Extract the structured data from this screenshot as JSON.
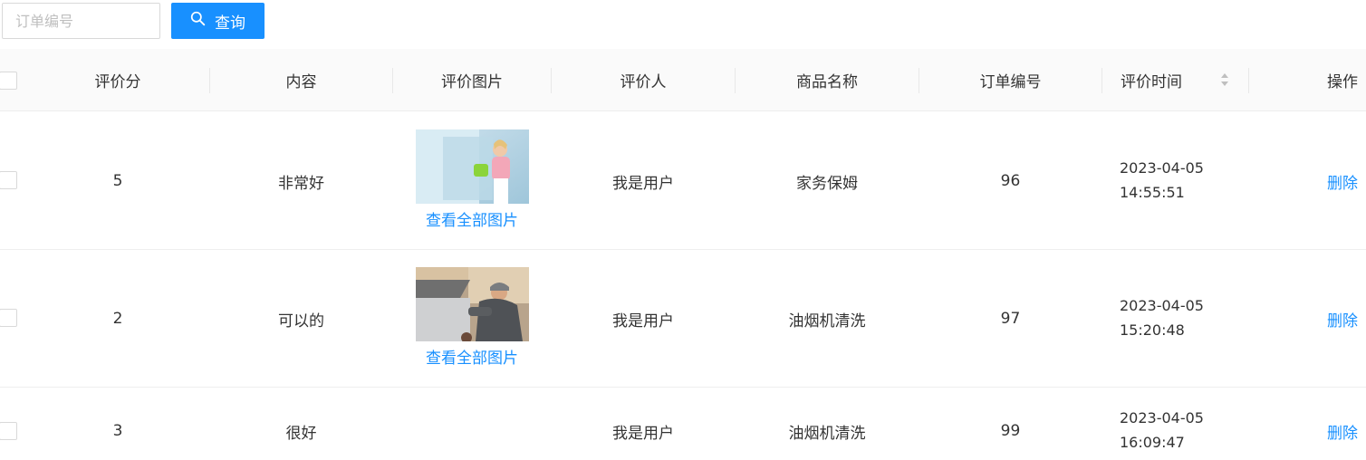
{
  "search": {
    "placeholder": "订单编号",
    "button_label": "查询"
  },
  "table": {
    "headers": {
      "score": "评价分",
      "content": "内容",
      "images": "评价图片",
      "reviewer": "评价人",
      "product": "商品名称",
      "order_no": "订单编号",
      "review_time": "评价时间",
      "action": "操作"
    },
    "rows": [
      {
        "score": "5",
        "content": "非常好",
        "view_images": "查看全部图片",
        "reviewer": "我是用户",
        "product": "家务保姆",
        "order_no": "96",
        "date": "2023-04-05",
        "time": "14:55:51",
        "action": "删除"
      },
      {
        "score": "2",
        "content": "可以的",
        "view_images": "查看全部图片",
        "reviewer": "我是用户",
        "product": "油烟机清洗",
        "order_no": "97",
        "date": "2023-04-05",
        "time": "15:20:48",
        "action": "删除"
      },
      {
        "score": "3",
        "content": "很好",
        "reviewer": "我是用户",
        "product": "油烟机清洗",
        "order_no": "99",
        "date": "2023-04-05",
        "time": "16:09:47",
        "action": "删除"
      }
    ]
  },
  "colors": {
    "primary": "#1890ff",
    "header_bg": "#fafafa",
    "border": "#eeeeee"
  }
}
